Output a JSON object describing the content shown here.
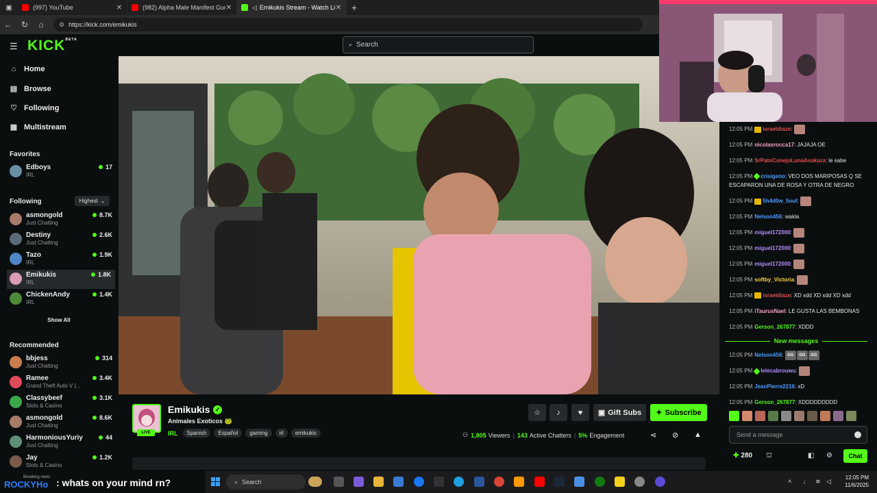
{
  "browser": {
    "tabs": [
      {
        "title": "(997) YouTube",
        "color": "#ff0000"
      },
      {
        "title": "(982) Alpha Male Manifest Guru F",
        "color": "#ff0000"
      },
      {
        "title": "Emikukis Stream - Watch Liv",
        "color": "#53fc18"
      }
    ],
    "url": "https://kick.com/emikukis"
  },
  "header": {
    "logo": "KICK",
    "logo_beta": "BETA",
    "search_placeholder": "Search"
  },
  "sidebar": {
    "nav": [
      {
        "label": "Home",
        "icon": "home-icon"
      },
      {
        "label": "Browse",
        "icon": "browse-icon"
      },
      {
        "label": "Following",
        "icon": "heart-icon"
      },
      {
        "label": "Multistream",
        "icon": "grid-icon"
      }
    ],
    "favorites_title": "Favorites",
    "favorites": [
      {
        "name": "Edboys",
        "category": "IRL",
        "viewers": "17"
      }
    ],
    "following_title": "Following",
    "sort_label": "Highest",
    "following": [
      {
        "name": "asmongold",
        "category": "Just Chatting",
        "viewers": "8.7K"
      },
      {
        "name": "Destiny",
        "category": "Just Chatting",
        "viewers": "2.6K"
      },
      {
        "name": "Tazo",
        "category": "IRL",
        "viewers": "1.9K"
      },
      {
        "name": "Emikukis",
        "category": "IRL",
        "viewers": "1.8K"
      },
      {
        "name": "ChickenAndy",
        "category": "IRL",
        "viewers": "1.4K"
      }
    ],
    "show_all": "Show All",
    "recommended_title": "Recommended",
    "recommended": [
      {
        "name": "bbjess",
        "category": "Just Chatting",
        "viewers": "314"
      },
      {
        "name": "Ramee",
        "category": "Grand Theft Auto V (...",
        "viewers": "3.4K"
      },
      {
        "name": "Classybeef",
        "category": "Slots & Casino",
        "viewers": "3.1K"
      },
      {
        "name": "asmongold",
        "category": "Just Chatting",
        "viewers": "8.6K"
      },
      {
        "name": "HarmoniousYuriy",
        "category": "Just Chatting",
        "viewers": "44"
      },
      {
        "name": "Jay",
        "category": "Slots & Casino",
        "viewers": "1.2K"
      }
    ]
  },
  "stream": {
    "name": "Emikukis",
    "title": "Animales Exoticos 🐸",
    "live": "LIVE",
    "category": "IRL",
    "tags": [
      "Spanish",
      "Español",
      "gaming",
      "irl",
      "emikukis"
    ],
    "gift_label": "Gift Subs",
    "subscribe_label": "Subscribe",
    "viewers": "1,805",
    "viewers_label": "Viewers",
    "chatters": "143",
    "chatters_label": "Active Chatters",
    "engagement": "5%",
    "engagement_label": "Engagement"
  },
  "chat": {
    "messages": [
      {
        "time": "12:05 PM",
        "user": "israeldiaze",
        "color": "#e64d4d",
        "badge": "crown",
        "text": "",
        "emotes": 1
      },
      {
        "time": "12:05 PM",
        "user": "nicolasrocca17",
        "color": "#f5a3c7",
        "badge": "",
        "text": "JAJAJA OE",
        "emotes": 0
      },
      {
        "time": "12:05 PM",
        "user": "SrPatoConejoLunaAsakura",
        "color": "#e64d4d",
        "badge": "",
        "text": "le sabe",
        "emotes": 0
      },
      {
        "time": "12:05 PM",
        "user": "crisigeno",
        "color": "#4d9bff",
        "badge": "gem",
        "text": "VEO DOS MARIPOSAS Q SE ESCAPARON UNA DE ROSA Y OTRA DE NEGRO",
        "emotes": 0
      },
      {
        "time": "12:05 PM",
        "user": "5h4d0w_5oul",
        "color": "#4d9bff",
        "badge": "crown",
        "text": "",
        "emotes": 1
      },
      {
        "time": "12:05 PM",
        "user": "Nelson456",
        "color": "#4d9bff",
        "badge": "",
        "text": "wakla",
        "emotes": 0
      },
      {
        "time": "12:05 PM",
        "user": "miguel172000",
        "color": "#b38cff",
        "badge": "",
        "text": "",
        "emotes": 1
      },
      {
        "time": "12:05 PM",
        "user": "miguel172000",
        "color": "#b38cff",
        "badge": "",
        "text": "",
        "emotes": 1
      },
      {
        "time": "12:05 PM",
        "user": "miguel172000",
        "color": "#b38cff",
        "badge": "",
        "text": "",
        "emotes": 1
      },
      {
        "time": "12:05 PM",
        "user": "softby_Victoria",
        "color": "#f5d04d",
        "badge": "",
        "text": "",
        "emotes": 1
      },
      {
        "time": "12:05 PM",
        "user": "israeldiaze",
        "color": "#e64d4d",
        "badge": "crown",
        "text": "XD xdd XD xdd XD xdd",
        "emotes": 0
      },
      {
        "time": "12:05 PM",
        "user": "iTaurusNael",
        "color": "#f5a3c7",
        "badge": "",
        "text": "LE GUSTA LAS BEMBONAS",
        "emotes": 0
      },
      {
        "time": "12:05 PM",
        "user": "Gerson_267877",
        "color": "#53fc18",
        "badge": "",
        "text": "XDDD",
        "emotes": 0
      }
    ],
    "new_messages_label": "New messages",
    "new_messages": [
      {
        "time": "12:05 PM",
        "user": "Nelson456",
        "color": "#4d9bff",
        "badge": "",
        "text": "",
        "gg": 3
      },
      {
        "time": "12:05 PM",
        "user": "lelecabrouwu",
        "color": "#b38cff",
        "badge": "gem",
        "text": "",
        "emotes": 1
      },
      {
        "time": "12:05 PM",
        "user": "JeanPierre2216",
        "color": "#4d9bff",
        "badge": "",
        "text": "xD",
        "emotes": 0
      },
      {
        "time": "12:05 PM",
        "user": "Gerson_267877",
        "color": "#53fc18",
        "badge": "",
        "text": "XDDDDDDDDD",
        "emotes": 0
      }
    ],
    "input_placeholder": "Send a message",
    "points": "280",
    "chat_button": "Chat"
  },
  "ticker": {
    "label": "Breaking news",
    "name": "ROCKYHo",
    "text": ": whats on your mind rn?"
  },
  "taskbar": {
    "search": "Search",
    "time": "12:05 PM",
    "date": "11/6/2025"
  },
  "colors": {
    "accent": "#53fc18",
    "background": "#0b0e0f"
  }
}
